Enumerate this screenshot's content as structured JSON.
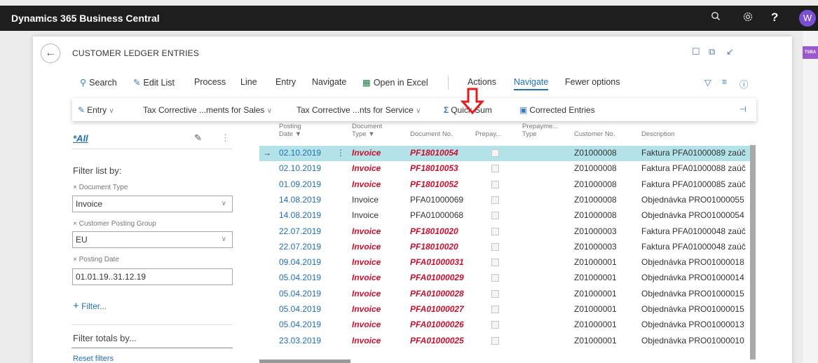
{
  "app": {
    "title": "Dynamics 365 Business Central",
    "avatar_letter": "W",
    "help": "?",
    "side_tab": "TSBA"
  },
  "page": {
    "title": "CUSTOMER LEDGER ENTRIES"
  },
  "actions": {
    "search": "Search",
    "edit_list": "Edit List",
    "process": "Process",
    "line": "Line",
    "entry": "Entry",
    "navigate": "Navigate",
    "open_excel": "Open in Excel",
    "actions": "Actions",
    "navigate_selected": "Navigate",
    "fewer_options": "Fewer options"
  },
  "subactions": {
    "entry": "Entry",
    "tax_sales": "Tax Corrective ...ments for Sales",
    "tax_service": "Tax Corrective ...nts for Service",
    "quick_sum": "Quick Sum",
    "corrected_entries": "Corrected Entries"
  },
  "filter": {
    "view": "*All",
    "filter_list_by": "Filter list by:",
    "doc_type_label": "Document Type",
    "doc_type_value": "Invoice",
    "cpg_label": "Customer Posting Group",
    "cpg_value": "EU",
    "posting_date_label": "Posting Date",
    "posting_date_value": "01.01.19..31.12.19",
    "add_filter": "Filter...",
    "filter_totals": "Filter totals by...",
    "reset": "Reset filters"
  },
  "table": {
    "headers": {
      "posting_date_1": "Posting",
      "posting_date_2": "Date",
      "doc_type_1": "Document",
      "doc_type_2": "Type",
      "doc_no": "Document No.",
      "prepay": "Prepay...",
      "prepay_type_1": "Prepayme...",
      "prepay_type_2": "Type",
      "customer_no": "Customer No.",
      "description": "Description"
    },
    "rows": [
      {
        "date": "02.10.2019",
        "type": "Invoice",
        "doc": "PF18010054",
        "cust": "Z01000008",
        "desc": "Faktura PFA01000089 zaúč"
      },
      {
        "date": "02.10.2019",
        "type": "Invoice",
        "doc": "PF18010053",
        "cust": "Z01000008",
        "desc": "Faktura PFA01000088 zaúč"
      },
      {
        "date": "01.09.2019",
        "type": "Invoice",
        "doc": "PF18010052",
        "cust": "Z01000008",
        "desc": "Faktura PFA01000085 zaúč"
      },
      {
        "date": "14.08.2019",
        "type": "Invoice",
        "doc": "PFA01000069",
        "cust": "Z01000008",
        "desc": "Objednávka PRO01000055"
      },
      {
        "date": "14.08.2019",
        "type": "Invoice",
        "doc": "PFA01000068",
        "cust": "Z01000008",
        "desc": "Objednávka PRO01000054"
      },
      {
        "date": "22.07.2019",
        "type": "Invoice",
        "doc": "PF18010020",
        "cust": "Z01000003",
        "desc": "Faktura PFA01000048 zaúč"
      },
      {
        "date": "22.07.2019",
        "type": "Invoice",
        "doc": "PF18010020",
        "cust": "Z01000003",
        "desc": "Faktura PFA01000048 zaúč"
      },
      {
        "date": "09.04.2019",
        "type": "Invoice",
        "doc": "PFA01000031",
        "cust": "Z01000001",
        "desc": "Objednávka PRO01000018"
      },
      {
        "date": "05.04.2019",
        "type": "Invoice",
        "doc": "PFA01000029",
        "cust": "Z01000001",
        "desc": "Objednávka PRO01000014"
      },
      {
        "date": "05.04.2019",
        "type": "Invoice",
        "doc": "PFA01000028",
        "cust": "Z01000001",
        "desc": "Objednávka PRO01000015"
      },
      {
        "date": "05.04.2019",
        "type": "Invoice",
        "doc": "PFA01000027",
        "cust": "Z01000001",
        "desc": "Objednávka PRO01000015"
      },
      {
        "date": "05.04.2019",
        "type": "Invoice",
        "doc": "PFA01000026",
        "cust": "Z01000001",
        "desc": "Objednávka PRO01000013"
      },
      {
        "date": "23.03.2019",
        "type": "Invoice",
        "doc": "PFA01000025",
        "cust": "Z01000001",
        "desc": "Objednávka PRO01000010"
      }
    ]
  },
  "colors": {
    "accent": "#1f6fb5",
    "selected_row": "#b3e3e8",
    "overdue_red": "#c8102e",
    "annotation_arrow": "#e21b1b"
  }
}
